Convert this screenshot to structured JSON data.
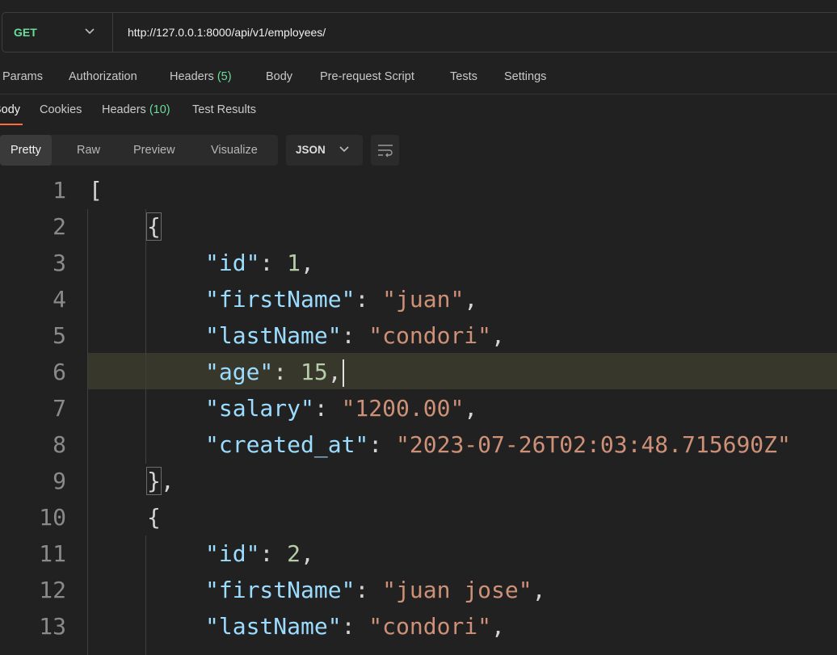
{
  "request": {
    "method": "GET",
    "url": "http://127.0.0.1:8000/api/v1/employees/"
  },
  "request_tabs": [
    {
      "label": "Params"
    },
    {
      "label": "Authorization"
    },
    {
      "label": "Headers",
      "count": "(5)"
    },
    {
      "label": "Body"
    },
    {
      "label": "Pre-request Script"
    },
    {
      "label": "Tests"
    },
    {
      "label": "Settings"
    }
  ],
  "response_tabs": [
    {
      "label": "Body"
    },
    {
      "label": "Cookies"
    },
    {
      "label": "Headers",
      "count": "(10)"
    },
    {
      "label": "Test Results"
    }
  ],
  "format_modes": [
    "Pretty",
    "Raw",
    "Preview",
    "Visualize"
  ],
  "format_selected": "JSON",
  "editor": {
    "line_numbers": [
      "1",
      "2",
      "3",
      "4",
      "5",
      "6",
      "7",
      "8",
      "9",
      "10",
      "11",
      "12",
      "13"
    ],
    "lines": [
      {
        "tokens": [
          {
            "t": "p",
            "v": "["
          }
        ]
      },
      {
        "tokens": [
          {
            "t": "p",
            "v": "{"
          }
        ]
      },
      {
        "tokens": [
          {
            "t": "k",
            "v": "\"id\""
          },
          {
            "t": "p",
            "v": ": "
          },
          {
            "t": "n",
            "v": "1"
          },
          {
            "t": "p",
            "v": ","
          }
        ]
      },
      {
        "tokens": [
          {
            "t": "k",
            "v": "\"firstName\""
          },
          {
            "t": "p",
            "v": ": "
          },
          {
            "t": "s",
            "v": "\"juan\""
          },
          {
            "t": "p",
            "v": ","
          }
        ]
      },
      {
        "tokens": [
          {
            "t": "k",
            "v": "\"lastName\""
          },
          {
            "t": "p",
            "v": ": "
          },
          {
            "t": "s",
            "v": "\"condori\""
          },
          {
            "t": "p",
            "v": ","
          }
        ]
      },
      {
        "tokens": [
          {
            "t": "k",
            "v": "\"age\""
          },
          {
            "t": "p",
            "v": ": "
          },
          {
            "t": "n",
            "v": "15"
          },
          {
            "t": "p",
            "v": ","
          }
        ]
      },
      {
        "tokens": [
          {
            "t": "k",
            "v": "\"salary\""
          },
          {
            "t": "p",
            "v": ": "
          },
          {
            "t": "s",
            "v": "\"1200.00\""
          },
          {
            "t": "p",
            "v": ","
          }
        ]
      },
      {
        "tokens": [
          {
            "t": "k",
            "v": "\"created_at\""
          },
          {
            "t": "p",
            "v": ": "
          },
          {
            "t": "s",
            "v": "\"2023-07-26T02:03:48.715690Z\""
          }
        ]
      },
      {
        "tokens": [
          {
            "t": "p",
            "v": "},"
          }
        ]
      },
      {
        "tokens": [
          {
            "t": "p",
            "v": "{"
          }
        ]
      },
      {
        "tokens": [
          {
            "t": "k",
            "v": "\"id\""
          },
          {
            "t": "p",
            "v": ": "
          },
          {
            "t": "n",
            "v": "2"
          },
          {
            "t": "p",
            "v": ","
          }
        ]
      },
      {
        "tokens": [
          {
            "t": "k",
            "v": "\"firstName\""
          },
          {
            "t": "p",
            "v": ": "
          },
          {
            "t": "s",
            "v": "\"juan jose\""
          },
          {
            "t": "p",
            "v": ","
          }
        ]
      },
      {
        "tokens": [
          {
            "t": "k",
            "v": "\"lastName\""
          },
          {
            "t": "p",
            "v": ": "
          },
          {
            "t": "s",
            "v": "\"condori\""
          },
          {
            "t": "p",
            "v": ","
          }
        ]
      }
    ]
  },
  "colors": {
    "method_get": "#6bdd9a",
    "active_tab_underline": "#ff6c37",
    "json_key": "#9cdcfe",
    "json_string": "#ce9178",
    "json_number": "#b5cea8"
  }
}
